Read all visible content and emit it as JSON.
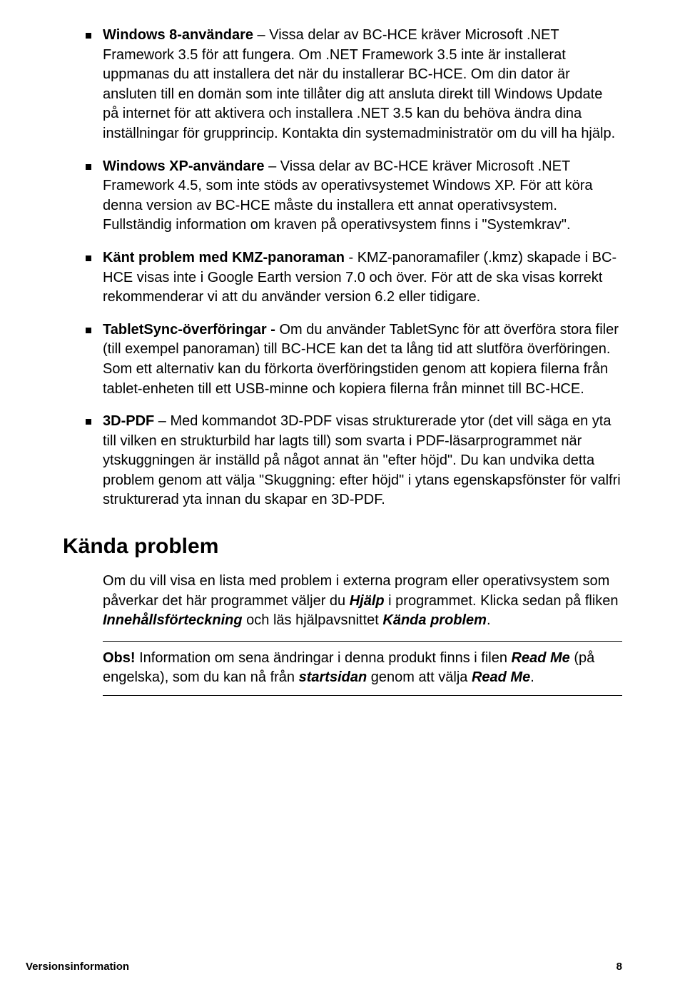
{
  "bullets": [
    {
      "bold": "Windows 8-användare",
      "text": " – Vissa delar av BC-HCE kräver Microsoft .NET Framework 3.5 för att fungera. Om .NET Framework 3.5 inte är installerat uppmanas du att installera det när du installerar BC-HCE. Om din dator är ansluten till en domän som inte tillåter dig att ansluta direkt till Windows Update på internet för att aktivera och installera .NET 3.5 kan du behöva ändra dina inställningar för grupprincip. Kontakta din systemadministratör om du vill ha hjälp."
    },
    {
      "bold": "Windows XP-användare",
      "text": " – Vissa delar av BC-HCE kräver Microsoft .NET Framework 4.5, som inte stöds av operativsystemet Windows XP. För att köra denna version av BC-HCE måste du installera ett annat operativsystem. Fullständig information om kraven på operativsystem finns i \"Systemkrav\"."
    },
    {
      "bold": "Känt problem med KMZ-panoraman",
      "text": " - KMZ-panoramafiler (.kmz) skapade i BC-HCE visas inte i Google Earth version 7.0 och över. För att de ska visas korrekt rekommenderar vi att du använder version 6.2 eller tidigare."
    },
    {
      "bold": "TabletSync-överföringar - ",
      "text": "Om du använder TabletSync för att överföra stora filer (till exempel panoraman) till BC-HCE kan det ta lång tid att slutföra överföringen. Som ett alternativ kan du förkorta överföringstiden genom att kopiera filerna från tablet-enheten till ett USB-minne och kopiera filerna från minnet till BC-HCE."
    },
    {
      "bold": "3D-PDF",
      "text": " – Med kommandot 3D-PDF visas strukturerade ytor (det vill säga en yta till vilken en strukturbild har lagts till) som svarta i PDF-läsarprogrammet när ytskuggningen är inställd på något annat än \"efter höjd\". Du kan undvika detta problem genom att välja \"Skuggning: efter höjd\" i ytans egenskapsfönster för valfri strukturerad yta innan du skapar en 3D-PDF."
    }
  ],
  "heading": "Kända problem",
  "para1_a": "Om du vill visa en lista med problem i externa program eller operativsystem som påverkar det här programmet väljer du ",
  "para1_hjalp": "Hjälp",
  "para1_b": " i programmet. Klicka sedan på fliken ",
  "para1_innehall": "Innehållsförteckning ",
  "para1_c": "och läs hjälpavsnittet ",
  "para1_kanda": "Kända problem",
  "para1_d": ".",
  "note_obs": "Obs!",
  "note_a": " Information om sena ändringar i denna produkt finns i filen ",
  "note_readme1": "Read Me",
  "note_b": " (på engelska), som du kan nå från ",
  "note_start": "startsidan",
  "note_c": " genom att välja ",
  "note_readme2": "Read Me",
  "note_d": ".",
  "footer_left": "Versionsinformation",
  "footer_right": "8"
}
